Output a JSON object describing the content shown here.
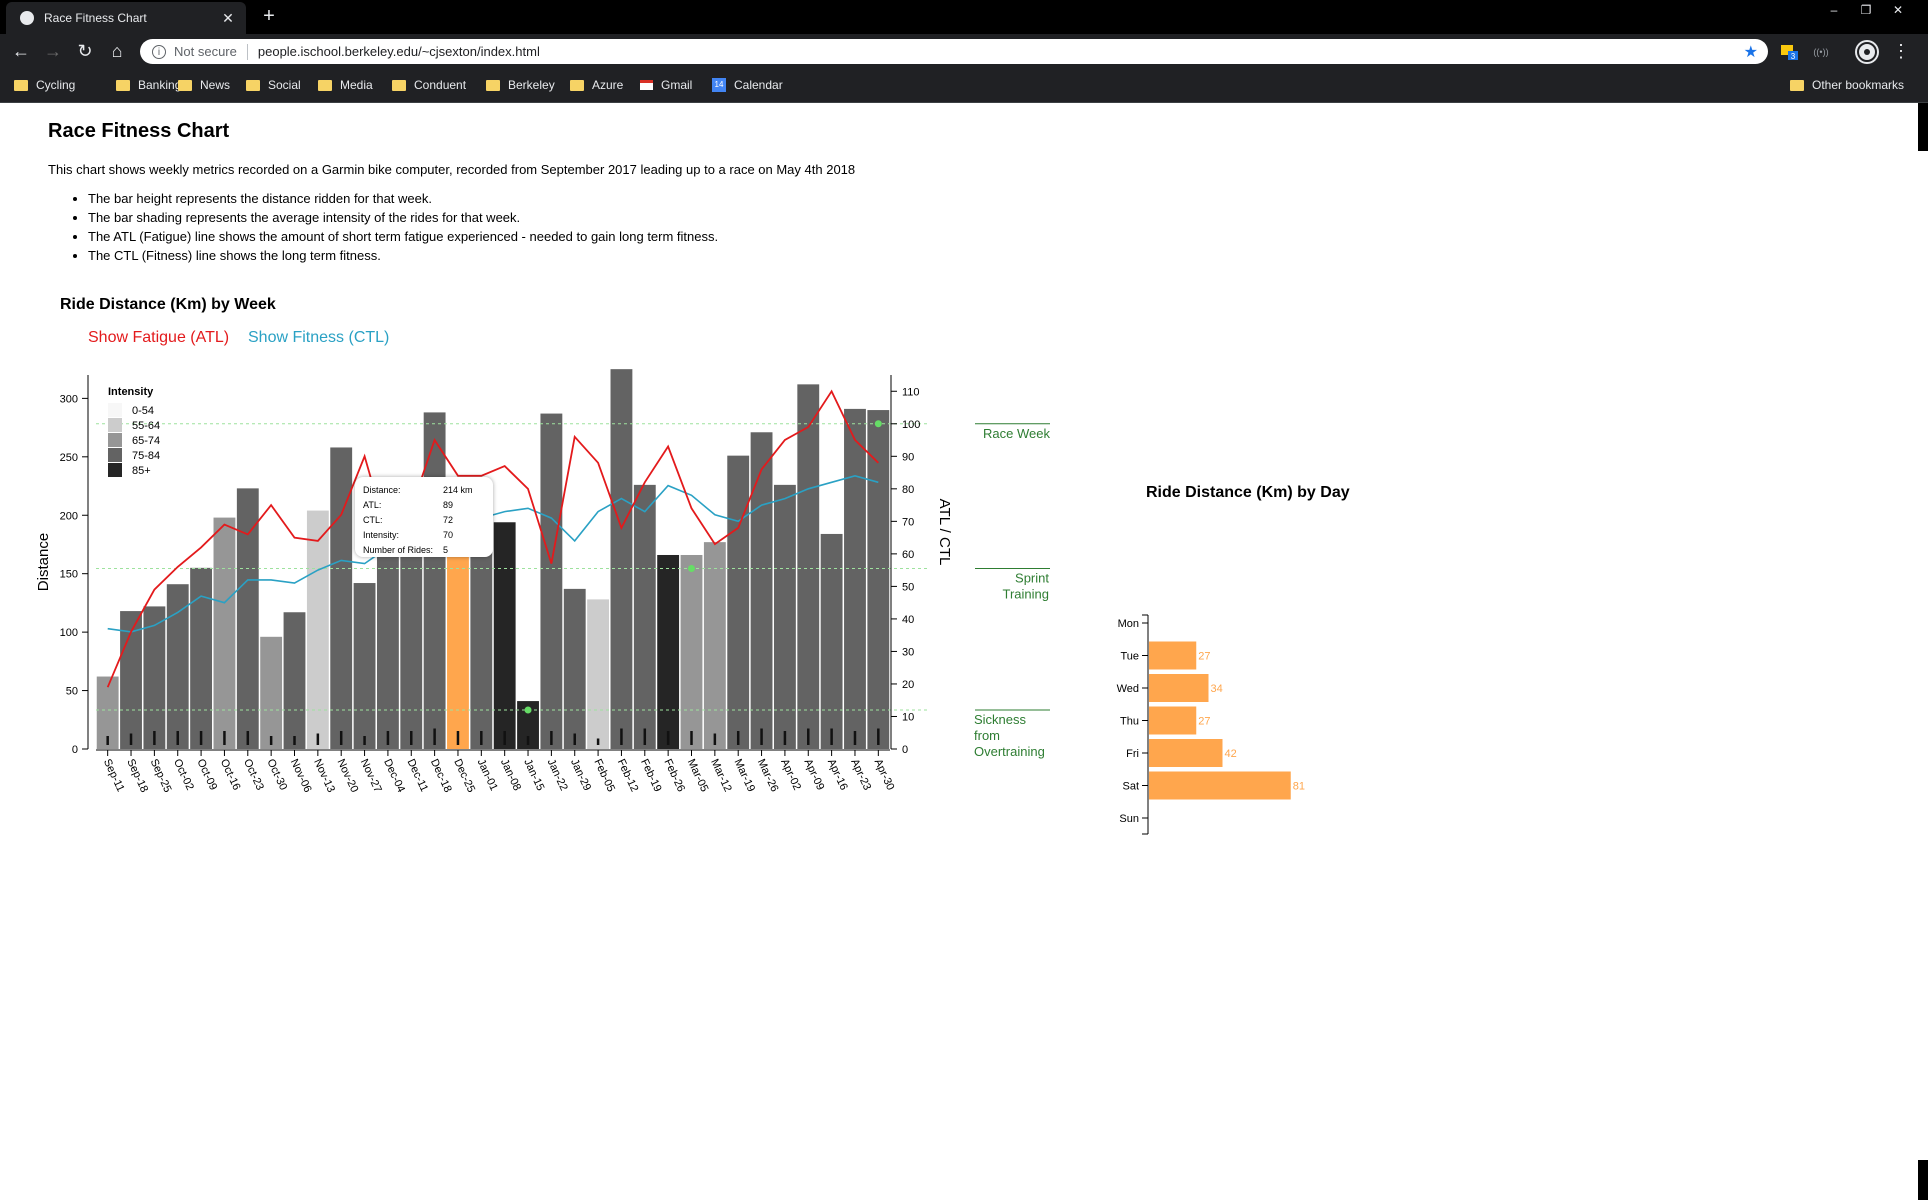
{
  "browser": {
    "tab_title": "Race Fitness Chart",
    "tab_close_icon": "close-icon",
    "new_tab_label": "+",
    "not_secure": "Not secure",
    "url": "people.ischool.berkeley.edu/~cjsexton/index.html",
    "extension_badge": "3",
    "bookmarks": [
      "Cycling",
      "Banking",
      "News",
      "Social",
      "Media",
      "Conduent",
      "Berkeley",
      "Azure",
      "Gmail",
      "Calendar"
    ],
    "calendar_icon_text": "14",
    "other_bookmarks": "Other bookmarks"
  },
  "page": {
    "title": "Race Fitness Chart",
    "intro": "This chart shows weekly metrics recorded on a Garmin bike computer, recorded from September 2017 leading up to a race on May 4th 2018",
    "bullets": [
      "The bar height represents the distance ridden for that week.",
      "The bar shading represents the average intensity of the rides for that week.",
      "The ATL (Fatigue) line shows the amount of short term fatigue experienced - needed to gain long term fitness.",
      "The CTL (Fitness) line shows the long term fitness."
    ],
    "weekly_title": "Ride Distance (Km) by Week",
    "toggle_atl": "Show Fatigue (ATL)",
    "toggle_ctl": "Show Fitness (CTL)",
    "daily_title": "Ride Distance (Km) by Day"
  },
  "colors": {
    "atl": "#e31a1c",
    "ctl": "#2aa1c4",
    "highlight": "#ffa64d",
    "annotation": "#2e7d32",
    "annotation_line": "#9ee29e",
    "marker": "#66dd66"
  },
  "tooltip": {
    "labels": [
      "Distance:",
      "ATL:",
      "CTL:",
      "Intensity:",
      "Number of Rides:"
    ],
    "values": [
      "214 km",
      "89",
      "72",
      "70",
      "5"
    ]
  },
  "chart_data": [
    {
      "type": "bar",
      "title": "Ride Distance (Km) by Week",
      "ylabel": "Distance",
      "y2label": "ATL / CTL",
      "ylim": [
        0,
        320
      ],
      "y2lim": [
        0,
        115
      ],
      "yticks": [
        0,
        50,
        100,
        150,
        200,
        250,
        300
      ],
      "y2ticks": [
        0,
        10,
        20,
        30,
        40,
        50,
        60,
        70,
        80,
        90,
        100,
        110
      ],
      "categories": [
        "Sep-11",
        "Sep-18",
        "Sep-25",
        "Oct-02",
        "Oct-09",
        "Oct-16",
        "Oct-23",
        "Oct-30",
        "Nov-06",
        "Nov-13",
        "Nov-20",
        "Nov-27",
        "Dec-04",
        "Dec-11",
        "Dec-18",
        "Dec-25",
        "Jan-01",
        "Jan-08",
        "Jan-15",
        "Jan-22",
        "Jan-29",
        "Feb-05",
        "Feb-12",
        "Feb-19",
        "Feb-26",
        "Mar-05",
        "Mar-12",
        "Mar-19",
        "Mar-26",
        "Apr-02",
        "Apr-09",
        "Apr-16",
        "Apr-23",
        "Apr-30"
      ],
      "distance": [
        62,
        118,
        122,
        141,
        155,
        198,
        223,
        96,
        117,
        204,
        258,
        142,
        202,
        228,
        288,
        214,
        193,
        194,
        41,
        287,
        137,
        128,
        325,
        226,
        166,
        166,
        177,
        251,
        271,
        226,
        312,
        184,
        291,
        290
      ],
      "intensity_class": [
        2,
        3,
        3,
        3,
        3,
        2,
        3,
        2,
        3,
        1,
        3,
        3,
        3,
        3,
        3,
        3,
        3,
        4,
        4,
        3,
        3,
        1,
        3,
        3,
        4,
        2,
        2,
        3,
        3,
        3,
        3,
        3,
        3,
        3
      ],
      "rides": [
        2,
        3,
        4,
        4,
        4,
        4,
        4,
        2,
        2,
        3,
        4,
        2,
        4,
        4,
        5,
        4,
        4,
        4,
        2,
        4,
        3,
        1,
        5,
        5,
        4,
        4,
        3,
        4,
        5,
        4,
        5,
        5,
        4,
        5
      ],
      "highlight_index": 15,
      "series": [
        {
          "name": "Fatigue (ATL)",
          "values": [
            19,
            36,
            49,
            56,
            62,
            69,
            66,
            75,
            65,
            64,
            72,
            90,
            65,
            74,
            95,
            84,
            84,
            87,
            80,
            57,
            96,
            88,
            68,
            82,
            93,
            74,
            63,
            68,
            86,
            95,
            99,
            110,
            95,
            88
          ]
        },
        {
          "name": "Fitness (CTL)",
          "values": [
            37,
            36,
            38,
            42,
            47,
            45,
            52,
            52,
            51,
            55,
            58,
            57,
            62,
            66,
            67,
            68,
            71,
            73,
            74,
            71,
            64,
            73,
            77,
            73,
            81,
            78,
            72,
            70,
            75,
            77,
            80,
            82,
            84,
            82
          ]
        }
      ],
      "annotations": [
        {
          "label": "Race Week",
          "y2": 100
        },
        {
          "label": "Sprint Training",
          "y2": 55.5
        },
        {
          "label": "Sickness from Overtraining",
          "y2": 12
        }
      ],
      "legend": {
        "title": "Intensity",
        "entries": [
          "0-54",
          "55-64",
          "65-74",
          "75-84",
          "85+"
        ],
        "colors": [
          "#f7f7f7",
          "#cccccc",
          "#969696",
          "#636363",
          "#252525"
        ],
        "position": "top-left"
      }
    },
    {
      "type": "bar",
      "orientation": "horizontal",
      "title": "Ride Distance (Km) by Day",
      "categories": [
        "Mon",
        "Tue",
        "Wed",
        "Thu",
        "Fri",
        "Sat",
        "Sun"
      ],
      "values": [
        0,
        27,
        34,
        27,
        42,
        81,
        0
      ],
      "data_labels": [
        "",
        "27",
        "34",
        "27",
        "42",
        "81",
        ""
      ],
      "xlim": [
        0,
        100
      ]
    }
  ]
}
